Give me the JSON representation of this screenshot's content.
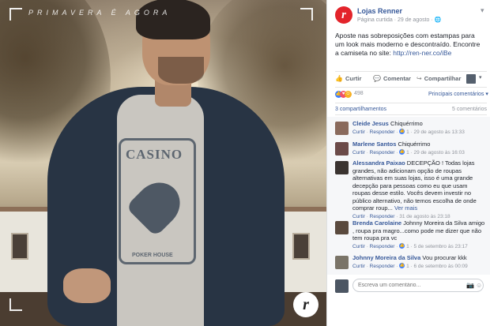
{
  "photo": {
    "tagline": "PRIMAVERA É AGORA",
    "logo_letter": "r",
    "shirt_text": "CASINO",
    "shirt_text2": "POKER HOUSE"
  },
  "post": {
    "page_name": "Lojas Renner",
    "page_letter": "r",
    "meta": "Página curtida · 29 de agosto · 🌐",
    "text": "Aposte nas sobreposições com estampas para um look mais moderno e descontraído. Encontre a camiseta no site: ",
    "link": "http://ren-ner.co/iBe",
    "actions": {
      "like": "Curtir",
      "comment": "Comentar",
      "share": "Compartilhar"
    },
    "reactions_count": "498",
    "filter_label": "Principais comentários ▾",
    "shares": "3 compartilhamentos",
    "comments_count": "5 comentários",
    "comments": [
      {
        "author": "Cleide Jesus",
        "text": "Chiquérrimo",
        "like_label": "Curtir",
        "reply_label": "Responder",
        "likes": "1",
        "date": "29 de agosto às 13:33",
        "avatar_color": "#8a6a5c"
      },
      {
        "author": "Marlene Santos",
        "text": "Chiquérrimo",
        "like_label": "Curtir",
        "reply_label": "Responder",
        "likes": "1",
        "date": "29 de agosto às 16:03",
        "avatar_color": "#6b4a48"
      },
      {
        "author": "Alessandra Paixao",
        "text": "DECEPÇÃO ! Todas lojas grandes, não adicionam opção de roupas alternativas em suas lojas, isso é uma grande decepção para pessoas como eu que usam roupas desse estilo. Vocês devem investir no público alternativo, não temos escolha de onde comprar roup...",
        "more": "Ver mais",
        "like_label": "Curtir",
        "reply_label": "Responder",
        "date": "31 de agosto às 23:18",
        "avatar_color": "#3a3330"
      },
      {
        "author": "Brenda Carolaine",
        "text": "Johnny Moreira da Silva amigo , roupa pra magro...como pode me dizer que não tem roupa pra vc",
        "like_label": "Curtir",
        "reply_label": "Responder",
        "likes": "1",
        "date": "5 de setembro às 23:17",
        "avatar_color": "#5a4a3e"
      },
      {
        "author": "Johnny Moreira da Silva",
        "text": "Vou procurar kkk",
        "like_label": "Curtir",
        "reply_label": "Responder",
        "likes": "1",
        "date": "6 de setembro às 00:09",
        "avatar_color": "#7a7468"
      }
    ],
    "reply_placeholder": "Escreva um comentário..."
  }
}
